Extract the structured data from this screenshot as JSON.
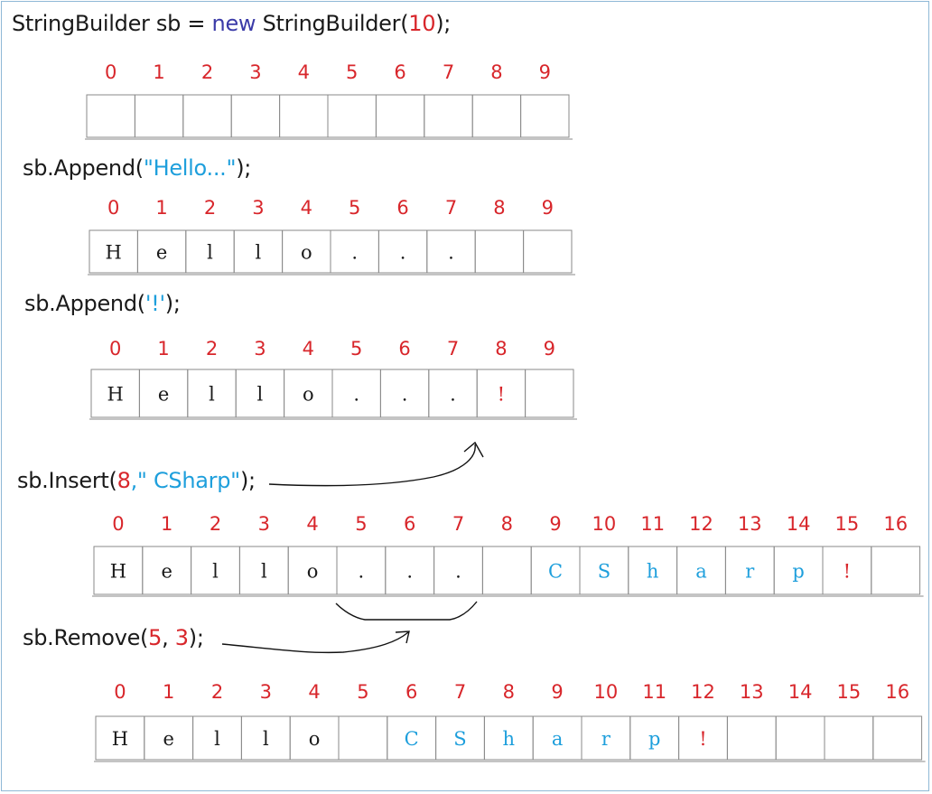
{
  "lines": {
    "l1": {
      "a": "StringBuilder sb = ",
      "kw": "new",
      "b": " StringBuilder(",
      "n": "10",
      "c": ");"
    },
    "l2": {
      "a": "sb.Append(",
      "s": "\"Hello...\"",
      "c": ");"
    },
    "l3": {
      "a": "sb.Append(",
      "s": "'!'",
      "c": ");"
    },
    "l4": {
      "a": "sb.Insert(",
      "n": "8",
      "comma": ",",
      "s": "\" CSharp\"",
      "c": ");"
    },
    "l5": {
      "a": "sb.Remove(",
      "n1": "5",
      "comma": ", ",
      "n2": "3",
      "c": ");"
    }
  },
  "colors": {
    "text": "#1a1a1a",
    "keyword": "#3b3ba8",
    "string": "#1e9fdc",
    "number": "#d8262b",
    "index": "#d8262b"
  },
  "rows": [
    {
      "name": "capacity-10-empty",
      "indices": [
        "0",
        "1",
        "2",
        "3",
        "4",
        "5",
        "6",
        "7",
        "8",
        "9"
      ],
      "cells": [
        "",
        "",
        "",
        "",
        "",
        "",
        "",
        "",
        "",
        ""
      ],
      "colors": []
    },
    {
      "name": "after-append-hello",
      "indices": [
        "0",
        "1",
        "2",
        "3",
        "4",
        "5",
        "6",
        "7",
        "8",
        "9"
      ],
      "cells": [
        "H",
        "e",
        "l",
        "l",
        "o",
        ".",
        ".",
        ".",
        "",
        ""
      ],
      "colors": []
    },
    {
      "name": "after-append-bang",
      "indices": [
        "0",
        "1",
        "2",
        "3",
        "4",
        "5",
        "6",
        "7",
        "8",
        "9"
      ],
      "cells": [
        "H",
        "e",
        "l",
        "l",
        "o",
        ".",
        ".",
        ".",
        "!",
        ""
      ],
      "colors": [
        "",
        "",
        "",
        "",
        "",
        "",
        "",
        "",
        "#d8262b",
        ""
      ]
    },
    {
      "name": "after-insert-csharp",
      "indices": [
        "0",
        "1",
        "2",
        "3",
        "4",
        "5",
        "6",
        "7",
        "8",
        "9",
        "10",
        "11",
        "12",
        "13",
        "14",
        "15",
        "16"
      ],
      "cells": [
        "H",
        "e",
        "l",
        "l",
        "o",
        ".",
        ".",
        ".",
        "",
        "C",
        "S",
        "h",
        "a",
        "r",
        "p",
        "!",
        ""
      ],
      "colors": [
        "",
        "",
        "",
        "",
        "",
        "",
        "",
        "",
        "",
        "#1e9fdc",
        "#1e9fdc",
        "#1e9fdc",
        "#1e9fdc",
        "#1e9fdc",
        "#1e9fdc",
        "#d8262b",
        ""
      ]
    },
    {
      "name": "after-remove",
      "indices": [
        "0",
        "1",
        "2",
        "3",
        "4",
        "5",
        "6",
        "7",
        "8",
        "9",
        "10",
        "11",
        "12",
        "13",
        "14",
        "15",
        "16"
      ],
      "cells": [
        "H",
        "e",
        "l",
        "l",
        "o",
        "",
        "C",
        "S",
        "h",
        "a",
        "r",
        "p",
        "!",
        "",
        "",
        "",
        ""
      ],
      "colors": [
        "",
        "",
        "",
        "",
        "",
        "",
        "#1e9fdc",
        "#1e9fdc",
        "#1e9fdc",
        "#1e9fdc",
        "#1e9fdc",
        "#1e9fdc",
        "#d8262b",
        "",
        "",
        "",
        ""
      ]
    }
  ]
}
